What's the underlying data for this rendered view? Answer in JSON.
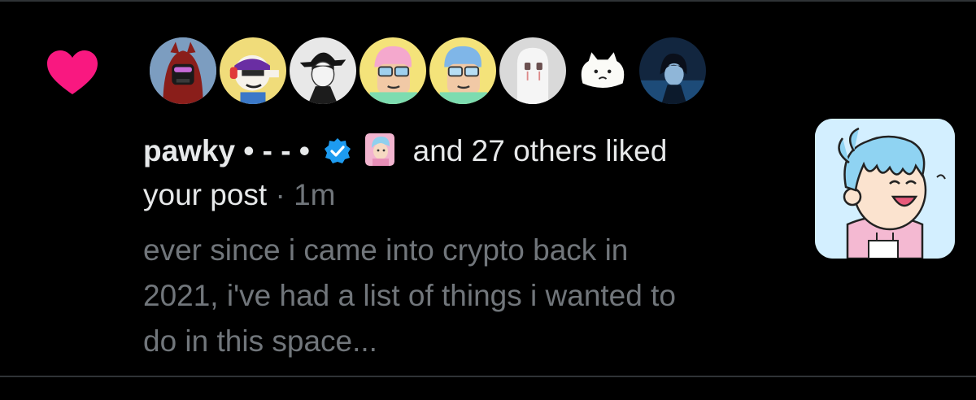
{
  "notification": {
    "type_icon": "heart-icon",
    "accent_color": "#f91880",
    "likers_avatars": [
      {
        "name": "avatar-red-hood",
        "icon": "red-hooded-character"
      },
      {
        "name": "avatar-yellow-headphones",
        "icon": "cartoon-with-headphones"
      },
      {
        "name": "avatar-bw-hat",
        "icon": "black-white-hat-portrait"
      },
      {
        "name": "avatar-pink-hair",
        "icon": "cartoon-pink-hair-glasses"
      },
      {
        "name": "avatar-blue-hair",
        "icon": "cartoon-blue-hair-glasses"
      },
      {
        "name": "avatar-white-mask",
        "icon": "white-mask-figure"
      },
      {
        "name": "avatar-white-cat",
        "icon": "white-cat"
      },
      {
        "name": "avatar-dark-anime",
        "icon": "dark-anime-portrait"
      }
    ],
    "primary_liker": {
      "display_name": "pawky",
      "name_suffix": " • - - •",
      "verified_icon": "verified-badge-icon"
    },
    "others_text": "and 27 others liked",
    "action_text": "your post",
    "separator": " · ",
    "timestamp": "1m",
    "preview_lines": [
      "ever since i came into crypto back in",
      "2021, i've had a list of things i wanted to",
      "do in this space..."
    ],
    "post_thumbnail_icon": "post-thumbnail-cartoon"
  }
}
